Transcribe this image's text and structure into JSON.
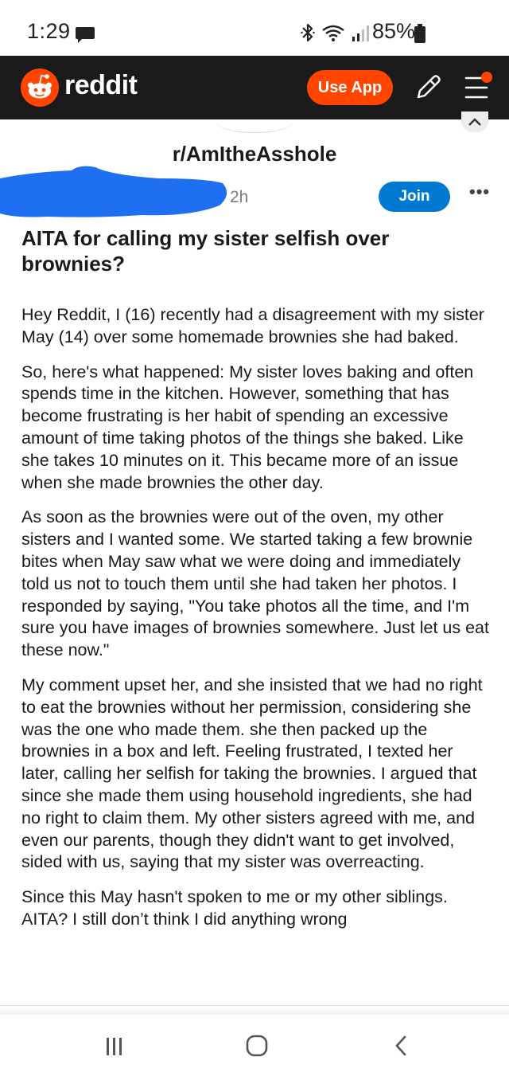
{
  "status_bar": {
    "time": "1:29",
    "battery": "85%"
  },
  "header": {
    "brand": "reddit",
    "use_app_label": "Use App",
    "brand_color": "#ff4500"
  },
  "subreddit": {
    "name": "r/AmItheAsshole"
  },
  "post": {
    "age": "2h",
    "join_label": "Join",
    "more_label": "•••",
    "title": "AITA for calling my sister selfish over brownies?",
    "paragraphs": [
      "Hey Reddit, I (16) recently had a disagreement with my sister May (14) over some homemade brownies she had baked.",
      "So, here's what happened: My sister loves baking and often spends time in the kitchen. However, something that has become frustrating is her habit of spending an excessive amount of time taking photos of the things she baked. Like she takes 10 minutes on it. This became more of an issue when she made brownies the other day.",
      "As soon as the brownies were out of the oven, my other sisters and I wanted some. We started taking a few brownie bites when May saw what we were doing and immediately told us not to touch them until she had taken her photos. I responded by saying, \"You take photos all the time, and I'm sure you have images of brownies somewhere. Just let us eat these now.\"",
      "My comment upset her, and she insisted that we had no right to eat the brownies without her permission, considering she was the one who made them. she then packed up the brownies in a box and left. Feeling frustrated, I texted her later, calling her selfish for taking the brownies. I argued that since she made them using household ingredients, she had no right to claim them. My other sisters agreed with me, and even our parents, though they didn't want to get involved, sided with us, saying that my sister was overreacting.",
      "Since this May hasn't spoken to me or my other siblings. AITA? I still don’t think I did anything wrong"
    ]
  },
  "icons": {
    "status": [
      "message-icon",
      "bluetooth-icon",
      "wifi-icon",
      "signal-icon",
      "battery-icon"
    ],
    "header": [
      "reddit-logo-icon",
      "pencil-icon",
      "menu-icon",
      "notification-dot-icon"
    ],
    "nav": [
      "recents-icon",
      "home-icon",
      "back-icon"
    ]
  },
  "colors": {
    "header_bg": "#1a1a1b",
    "join_button": "#0079d3",
    "redaction": "#1f6ff2"
  }
}
